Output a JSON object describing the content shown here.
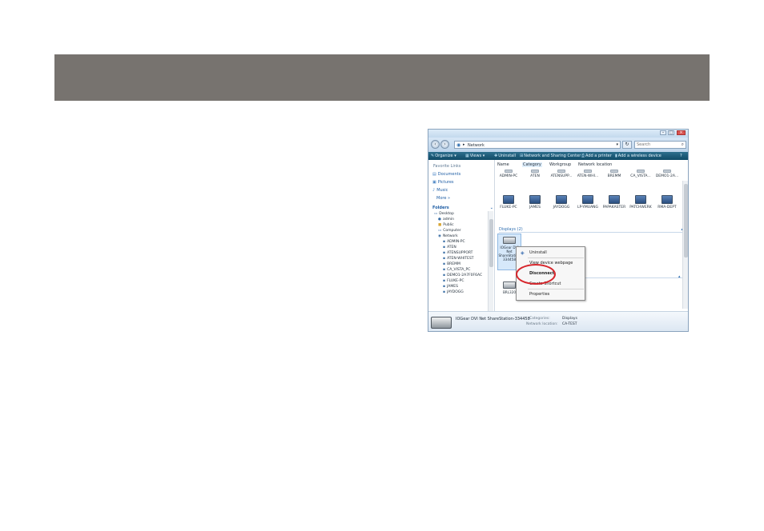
{
  "window": {
    "address_path": "Network",
    "search_placeholder": "Search"
  },
  "toolbar": {
    "organize": "Organize",
    "views": "Views",
    "uninstall": "Uninstall",
    "network_center": "Network and Sharing Center",
    "add_printer": "Add a printer",
    "add_wireless": "Add a wireless device"
  },
  "sidebar": {
    "favorite_links_title": "Favorite Links",
    "links": [
      "Documents",
      "Pictures",
      "Music"
    ],
    "more": "More",
    "folders_title": "Folders",
    "tree": [
      "Desktop",
      "admin",
      "Public",
      "Computer",
      "Network",
      "ADMIN-PC",
      "ATEN",
      "ATENSUPPORT",
      "ATEN-WHITEST",
      "BREMM",
      "CA_VISTA_PC",
      "DEMO1-2A7F0F6AC",
      "FLUKE-PC",
      "JAMES",
      "JAYDOGG"
    ]
  },
  "columns": [
    "Name",
    "Category",
    "Workgroup",
    "Network location"
  ],
  "computers_row1": [
    "ADMIN-PC",
    "ATEN",
    "ATENSUPP...",
    "ATEN-WHI...",
    "BREMM",
    "CA_VISTA...",
    "DEMO1-2A..."
  ],
  "computers_row2": [
    "FLUKE-PC",
    "JAMES",
    "JAYDOGG",
    "LP-YMUANG",
    "PAPAKASTER",
    "PATCHWERK",
    "RMA-DEPT"
  ],
  "displays_group": "Displays (2)",
  "devices": {
    "selected_lines": [
      "IOGear DVI",
      "Net",
      "ShareStation",
      "334458"
    ],
    "second": "BRL320"
  },
  "context_menu": {
    "uninstall": "Uninstall",
    "view_webpage": "View device webpage",
    "disconnect": "Disconnect",
    "shortcut": "Create Shortcut",
    "properties": "Properties"
  },
  "details": {
    "device_name": "IOGear DVI Net ShareStation-334458",
    "categories_label": "Categories:",
    "categories_value": "Displays",
    "location_label": "Network location:",
    "location_value": "CA-TEST"
  },
  "colors": {
    "header_band": "#77736f",
    "highlight": "#d7272d",
    "toolbar": "#1a5775"
  }
}
